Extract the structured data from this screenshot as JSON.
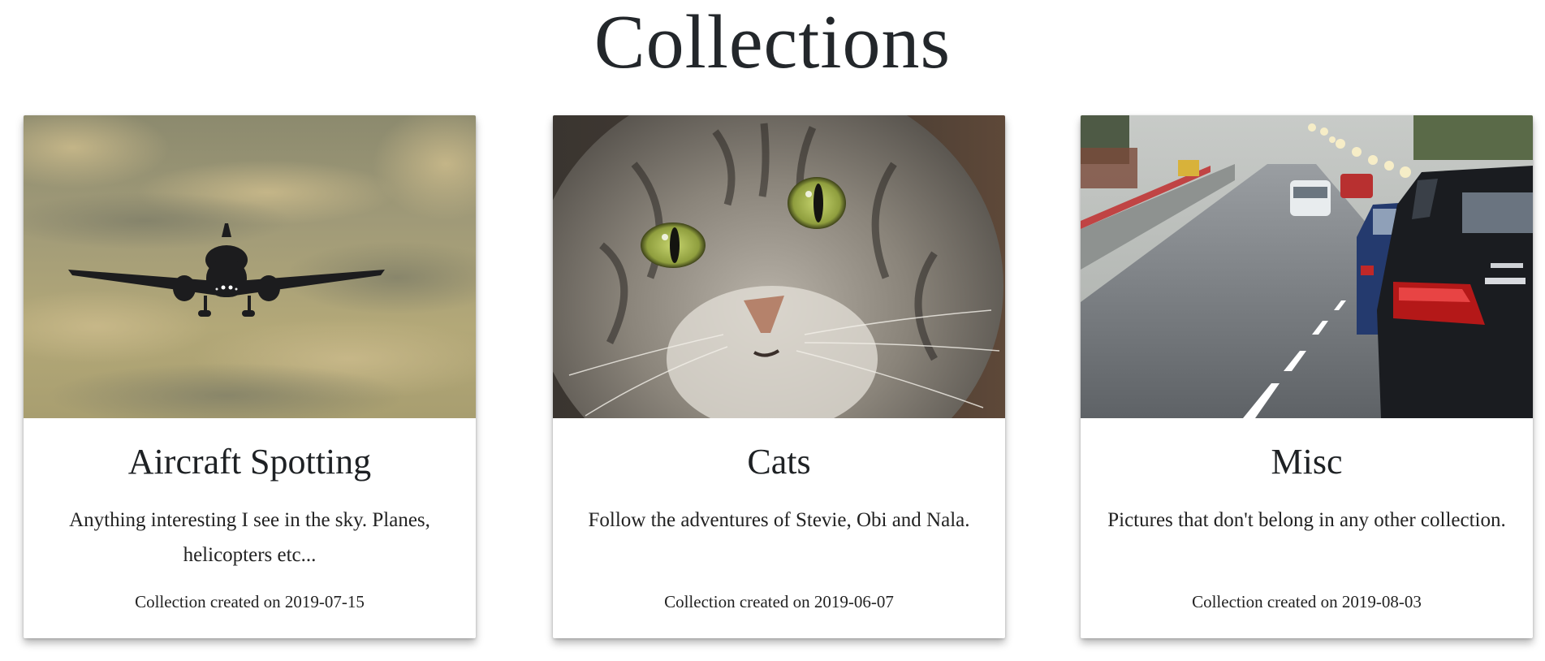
{
  "page": {
    "title": "Collections"
  },
  "collections": [
    {
      "title": "Aircraft Spotting",
      "description": "Anything interesting I see in the sky. Planes, helicopters etc...",
      "created": "Collection created on 2019-07-15",
      "image": "airplane-photo"
    },
    {
      "title": "Cats",
      "description": "Follow the adventures of Stevie, Obi and Nala.",
      "created": "Collection created on 2019-06-07",
      "image": "cat-photo"
    },
    {
      "title": "Misc",
      "description": "Pictures that don't belong in any other collection.",
      "created": "Collection created on 2019-08-03",
      "image": "traffic-photo"
    }
  ]
}
